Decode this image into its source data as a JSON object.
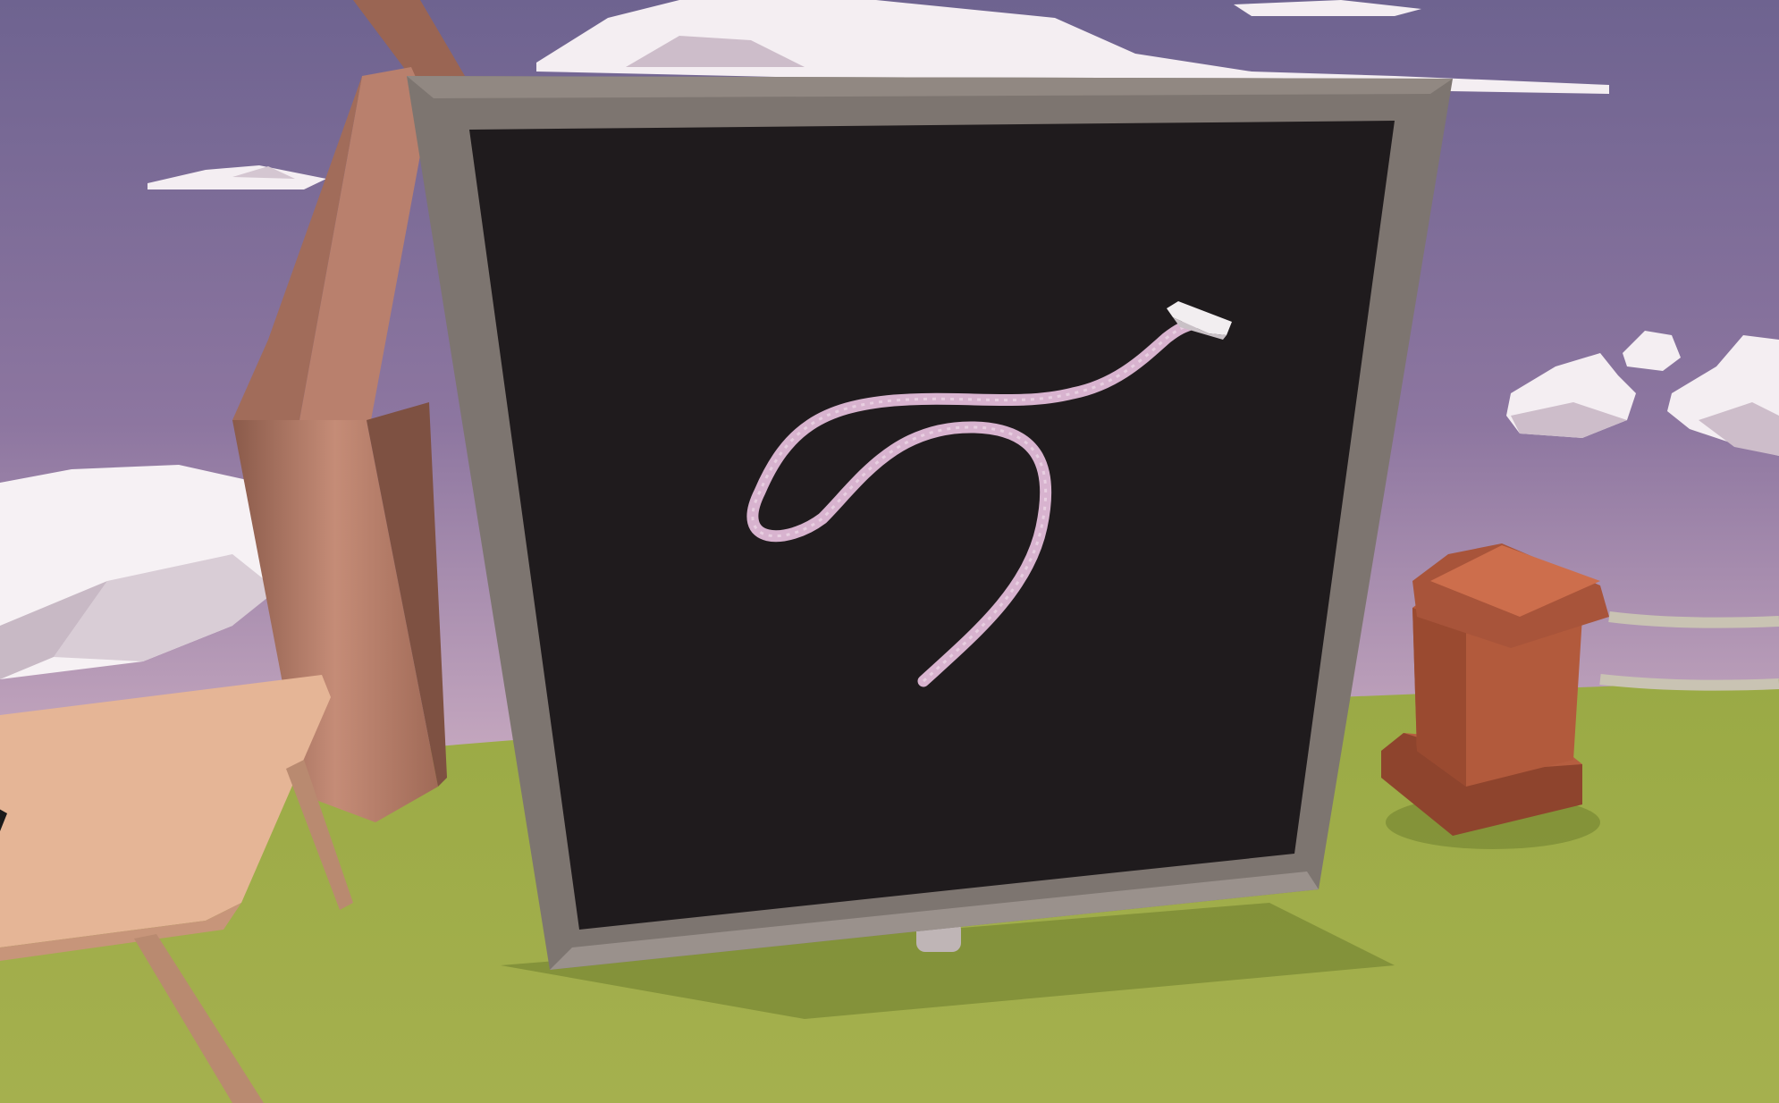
{
  "scene": {
    "sky_top": "#6e6390",
    "sky_mid": "#8d76a0",
    "sky_horizon": "#c7a9c0",
    "ground_color": "#9fae4b",
    "ground_shadow": "#6f7f2e"
  },
  "chalkboard": {
    "frame_color": "#7d7570",
    "board_color": "#1f1b1d",
    "stand_color": "#bfb5b6"
  },
  "chalk_drawing": {
    "stroke_color": "#d8b3cf",
    "chalk_color": "#f2eef0"
  },
  "easel": {
    "wood_color": "#b9806d"
  },
  "desk": {
    "top_color": "#e5b596",
    "leg_color": "#b98a70"
  },
  "pedestal": {
    "color": "#b25a3c",
    "top_color": "#cd6e4c"
  },
  "clouds": {
    "color": "#f4eef2",
    "shade": "#cdbdca"
  }
}
